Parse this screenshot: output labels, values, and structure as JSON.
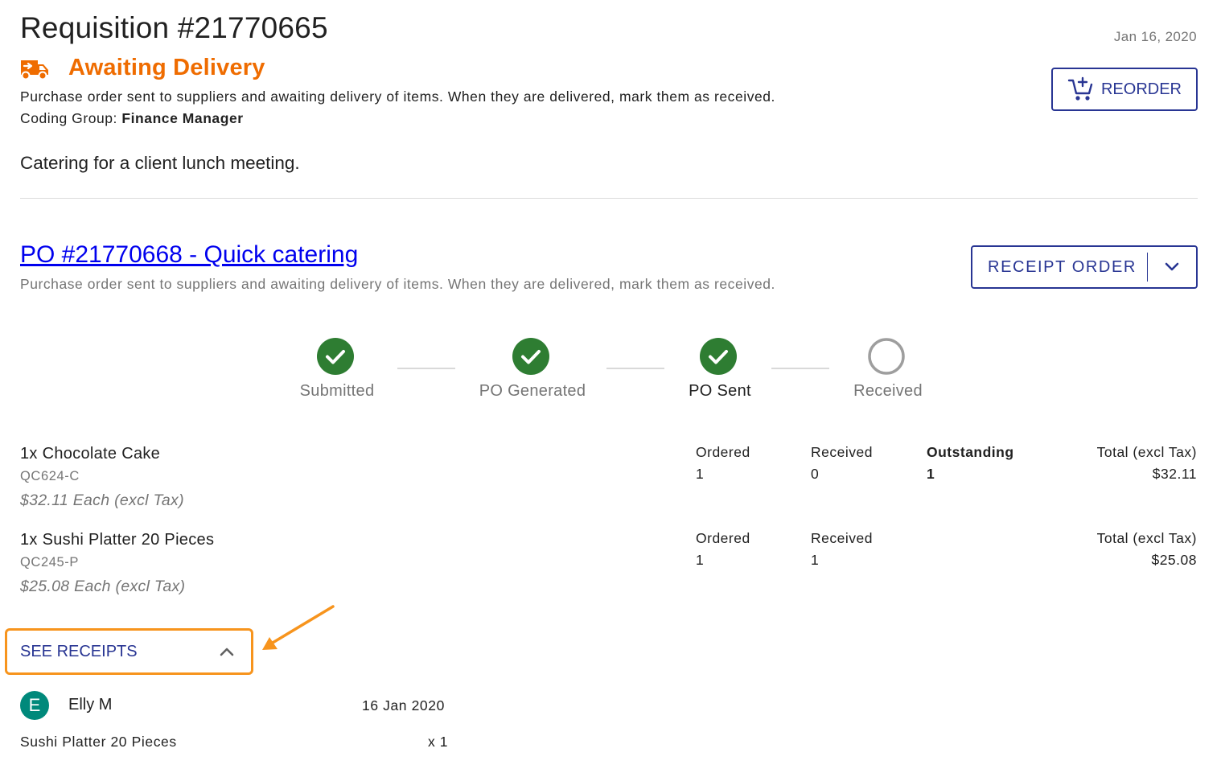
{
  "requisition": {
    "title": "Requisition #21770665",
    "date": "Jan 16, 2020",
    "status": "Awaiting Delivery",
    "status_color": "#ef6c00",
    "status_description": "Purchase order sent to suppliers and awaiting delivery of items. When they are delivered, mark them as received.",
    "coding_group_label": "Coding Group:",
    "coding_group_value": "Finance Manager",
    "purpose": "Catering for a client lunch meeting.",
    "reorder_label": "REORDER"
  },
  "purchase_order": {
    "link_text": "PO #21770668 - Quick catering",
    "description": "Purchase order sent to suppliers and awaiting delivery of items. When they are delivered, mark them as received.",
    "receipt_button_label": "RECEIPT ORDER"
  },
  "steps": [
    {
      "label": "Submitted",
      "state": "done"
    },
    {
      "label": "PO Generated",
      "state": "done"
    },
    {
      "label": "PO Sent",
      "state": "current"
    },
    {
      "label": "Received",
      "state": "pending"
    }
  ],
  "items": [
    {
      "name": "1x Chocolate Cake",
      "sku": "QC624-C",
      "price": "$32.11 Each (excl Tax)",
      "ordered_label": "Ordered",
      "ordered": "1",
      "received_label": "Received",
      "received": "0",
      "outstanding_label": "Outstanding",
      "outstanding": "1",
      "total_label": "Total (excl Tax)",
      "total": "$32.11"
    },
    {
      "name": "1x Sushi Platter 20 Pieces",
      "sku": "QC245-P",
      "price": "$25.08 Each (excl Tax)",
      "ordered_label": "Ordered",
      "ordered": "1",
      "received_label": "Received",
      "received": "1",
      "total_label": "Total (excl Tax)",
      "total": "$25.08"
    }
  ],
  "receipts": {
    "toggle_label": "SEE RECEIPTS",
    "entries": [
      {
        "avatar_initial": "E",
        "user": "Elly M",
        "date": "16 Jan 2020",
        "item": "Sushi Platter 20 Pieces",
        "qty": "x 1"
      }
    ]
  },
  "colors": {
    "primary": "#283593",
    "success": "#2e7d32",
    "highlight": "#f7941d",
    "avatar": "#00897b"
  },
  "icons": {
    "status": "delivery-truck-icon",
    "reorder": "cart-add-icon",
    "dropdown": "chevron-down-icon",
    "toggle": "chevron-up-icon",
    "step_done": "check-circle-icon",
    "step_pending": "empty-circle-icon"
  }
}
